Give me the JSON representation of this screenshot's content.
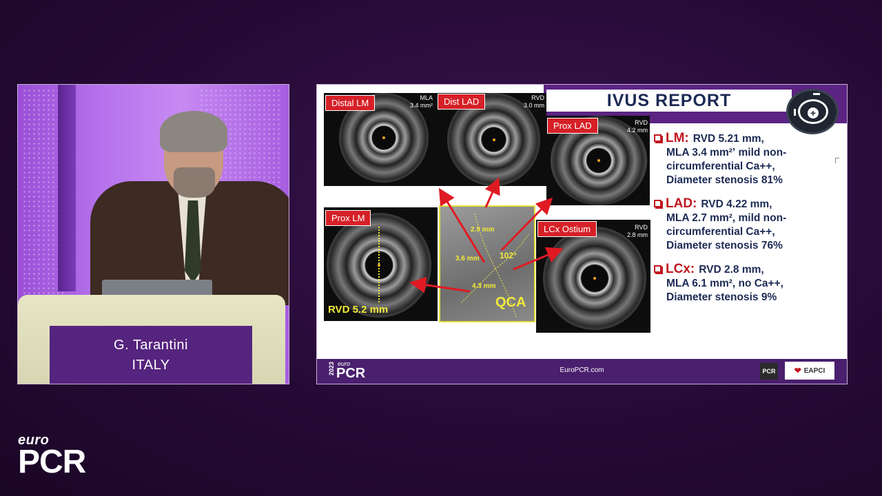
{
  "speaker": {
    "name": "G. Tarantini",
    "country": "ITALY"
  },
  "slide": {
    "title": "IVUS REPORT",
    "panels": [
      {
        "label": "Distal LM",
        "measure_name": "MLA",
        "measure_value": "3.4 mm²"
      },
      {
        "label": "Dist LAD",
        "measure_name": "RVD",
        "measure_value": "3.0 mm"
      },
      {
        "label": "Prox LAD",
        "measure_name": "RVD",
        "measure_value": "4.2 mm"
      },
      {
        "label": "Prox LM",
        "measure_name": "",
        "measure_value": ""
      },
      {
        "label": "LCx Ostium",
        "measure_name": "RVD",
        "measure_value": "2.8 mm"
      }
    ],
    "prox_lm_rvd": "RVD 5.2 mm",
    "qca": {
      "label": "QCA",
      "angle": "102°",
      "segments": [
        "2.9 mm",
        "3.6 mm",
        "4.3 mm"
      ]
    },
    "findings": [
      {
        "key": "LM:",
        "first_line": "RVD 5.21 mm,",
        "lines": [
          "MLA 3.4 mm²ʼ mild non-",
          "circumferential Ca++,",
          "Diameter stenosis 81%"
        ]
      },
      {
        "key": "LAD:",
        "first_line": "RVD 4.22 mm,",
        "lines": [
          "MLA 2.7 mm², mild non-",
          "circumferential Ca++,",
          "Diameter stenosis 76%"
        ]
      },
      {
        "key": "LCx:",
        "first_line": "RVD 2.8 mm,",
        "lines": [
          "MLA 6.1 mm², no Ca++,",
          "Diameter stenosis 9%"
        ]
      }
    ],
    "footer": {
      "year": "2023",
      "euro": "euro",
      "pcr": "PCR",
      "url": "EuroPCR.com",
      "pcr_badge": "PCR",
      "eapci": "EAPCI"
    }
  },
  "brand": {
    "euro": "euro",
    "pcr": "PCR"
  },
  "colors": {
    "background": "#260a36",
    "accent_purple": "#5b2483",
    "alert_red": "#d62027",
    "text_navy": "#1c2a55",
    "highlight_yellow": "#f2ea3a"
  }
}
